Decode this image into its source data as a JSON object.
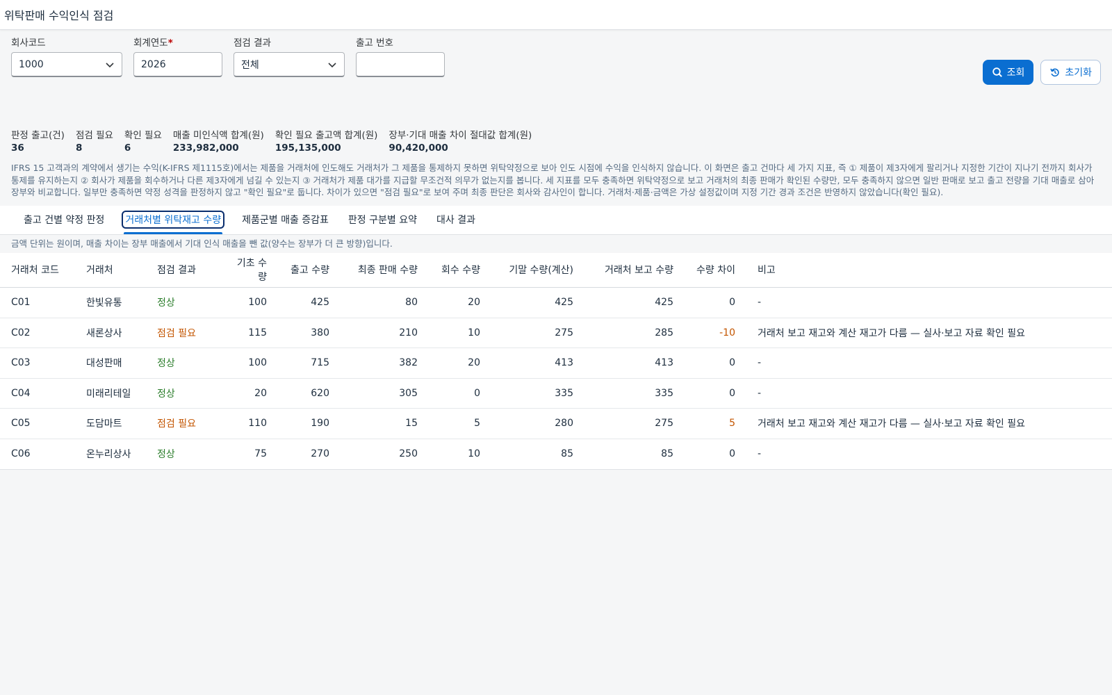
{
  "header": {
    "title": "위탁판매 수익인식 점검"
  },
  "filters": {
    "company": {
      "label": "회사코드",
      "value": "1000"
    },
    "year": {
      "label": "회계연도",
      "required_mark": "*",
      "value": "2026"
    },
    "result": {
      "label": "점검 결과",
      "value": "전체"
    },
    "shipment": {
      "label": "출고 번호",
      "value": ""
    }
  },
  "buttons": {
    "search": "조회",
    "reset": "초기화"
  },
  "kpis": [
    {
      "label": "판정 출고(건)",
      "value": "36"
    },
    {
      "label": "점검 필요",
      "value": "8"
    },
    {
      "label": "확인 필요",
      "value": "6"
    },
    {
      "label": "매출 미인식액 합계(원)",
      "value": "233,982,000"
    },
    {
      "label": "확인 필요 출고액 합계(원)",
      "value": "195,135,000"
    },
    {
      "label": "장부·기대 매출 차이 절대값 합계(원)",
      "value": "90,420,000"
    }
  ],
  "description": "IFRS 15 고객과의 계약에서 생기는 수익(K-IFRS 제1115호)에서는 제품을 거래처에 인도해도 거래처가 그 제품을 통제하지 못하면 위탁약정으로 보아 인도 시점에 수익을 인식하지 않습니다. 이 화면은 출고 건마다 세 가지 지표, 즉 ① 제품이 제3자에게 팔리거나 지정한 기간이 지나기 전까지 회사가 통제를 유지하는지 ② 회사가 제품을 회수하거나 다른 제3자에게 넘길 수 있는지 ③ 거래처가 제품 대가를 지급할 무조건적 의무가 없는지를 봅니다. 세 지표를 모두 충족하면 위탁약정으로 보고 거래처의 최종 판매가 확인된 수량만, 모두 충족하지 않으면 일반 판매로 보고 출고 전량을 기대 매출로 삼아 장부와 비교합니다. 일부만 충족하면 약정 성격을 판정하지 않고 \"확인 필요\"로 둡니다. 차이가 있으면 \"점검 필요\"로 보여 주며 최종 판단은 회사와 감사인이 합니다. 거래처·제품·금액은 가상 설정값이며 지정 기간 경과 조건은 반영하지 않았습니다(확인 필요).",
  "tabs": [
    {
      "label": "출고 건별 약정 판정",
      "active": false
    },
    {
      "label": "거래처별 위탁재고 수량",
      "active": true
    },
    {
      "label": "제품군별 매출 증감표",
      "active": false
    },
    {
      "label": "판정 구분별 요약",
      "active": false
    },
    {
      "label": "대사 결과",
      "active": false
    }
  ],
  "note": "금액 단위는 원이며, 매출 차이는 장부 매출에서 기대 인식 매출을 뺀 값(양수는 장부가 더 큰 방향)입니다.",
  "table": {
    "columns": [
      "거래처 코드",
      "거래처",
      "점검 결과",
      "기초 수량",
      "출고 수량",
      "최종 판매 수량",
      "회수 수량",
      "기말 수량(계산)",
      "거래처 보고 수량",
      "수량 차이",
      "비고"
    ],
    "rows": [
      [
        "C01",
        "한빛유통",
        "정상",
        "100",
        "425",
        "80",
        "20",
        "425",
        "425",
        "0",
        "-"
      ],
      [
        "C02",
        "새론상사",
        "점검 필요",
        "115",
        "380",
        "210",
        "10",
        "275",
        "285",
        "-10",
        "거래처 보고 재고와 계산 재고가 다름 — 실사·보고 자료 확인 필요"
      ],
      [
        "C03",
        "대성판매",
        "정상",
        "100",
        "715",
        "382",
        "20",
        "413",
        "413",
        "0",
        "-"
      ],
      [
        "C04",
        "미래리테일",
        "정상",
        "20",
        "620",
        "305",
        "0",
        "335",
        "335",
        "0",
        "-"
      ],
      [
        "C05",
        "도담마트",
        "점검 필요",
        "110",
        "190",
        "15",
        "5",
        "280",
        "275",
        "5",
        "거래처 보고 재고와 계산 재고가 다름 — 실사·보고 자료 확인 필요"
      ],
      [
        "C06",
        "온누리상사",
        "정상",
        "75",
        "270",
        "250",
        "10",
        "85",
        "85",
        "0",
        "-"
      ]
    ]
  },
  "colors": {
    "accent": "#0a6ed1",
    "ok": "#2b7d2b",
    "warn": "#c35500"
  }
}
